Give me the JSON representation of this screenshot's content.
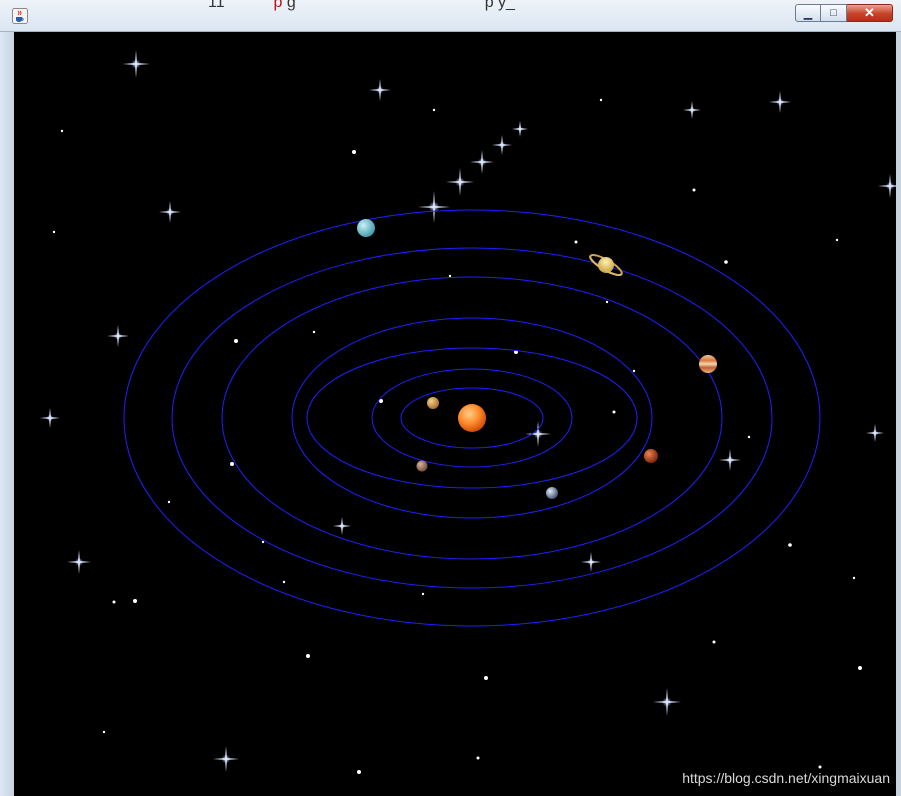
{
  "window": {
    "title_left": "11",
    "title_red": "p",
    "title_mid": "g",
    "title_right": "p y_",
    "min_glyph": "▁",
    "max_glyph": "□",
    "close_glyph": "✕"
  },
  "icons": {
    "app": "java-coffee-cup-icon",
    "minimize": "minimize-icon",
    "maximize": "maximize-icon",
    "close": "close-icon"
  },
  "scene": {
    "background": "#000000",
    "orbit_color": "#1f1fff",
    "orbit_count": 7,
    "bodies": [
      {
        "name": "sun",
        "color": "#ff8a2a"
      },
      {
        "name": "mercury",
        "color": "#d8a050"
      },
      {
        "name": "venus",
        "color": "#b08060"
      },
      {
        "name": "earth",
        "color": "#8aa0c0"
      },
      {
        "name": "mars",
        "color": "#c24a1e"
      },
      {
        "name": "jupiter",
        "color": "#e39a5a"
      },
      {
        "name": "saturn",
        "color": "#e3c76a"
      },
      {
        "name": "uranus",
        "color": "#7fd0d8"
      }
    ]
  },
  "watermark": "https://blog.csdn.net/xingmaixuan"
}
